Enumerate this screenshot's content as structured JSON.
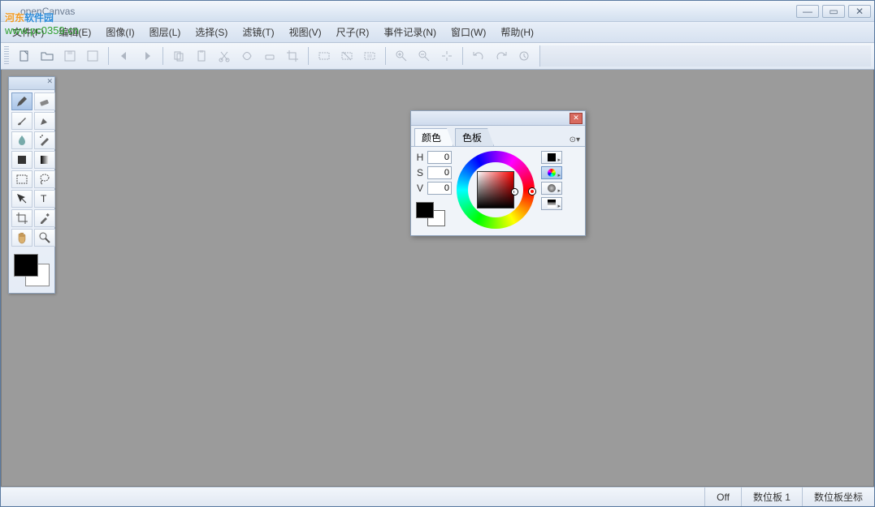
{
  "window": {
    "title": "openCanvas"
  },
  "menu": {
    "file": "文件(F)",
    "edit": "编辑(E)",
    "image": "图像(I)",
    "layer": "图层(L)",
    "select": "选择(S)",
    "filter": "滤镜(T)",
    "view": "视图(V)",
    "ruler": "尺子(R)",
    "events": "事件记录(N)",
    "window": "窗口(W)",
    "help": "帮助(H)"
  },
  "status": {
    "off": "Off",
    "tablet": "数位板 1",
    "coords": "数位板坐标"
  },
  "colorpanel": {
    "tab_color": "颜色",
    "tab_swatch": "色板",
    "h_label": "H",
    "s_label": "S",
    "v_label": "V",
    "h_val": "0",
    "s_val": "0",
    "v_val": "0"
  },
  "watermark": {
    "line1_a": "河东",
    "line1_b": "软件园",
    "line2": "www.pc0359.cn"
  }
}
